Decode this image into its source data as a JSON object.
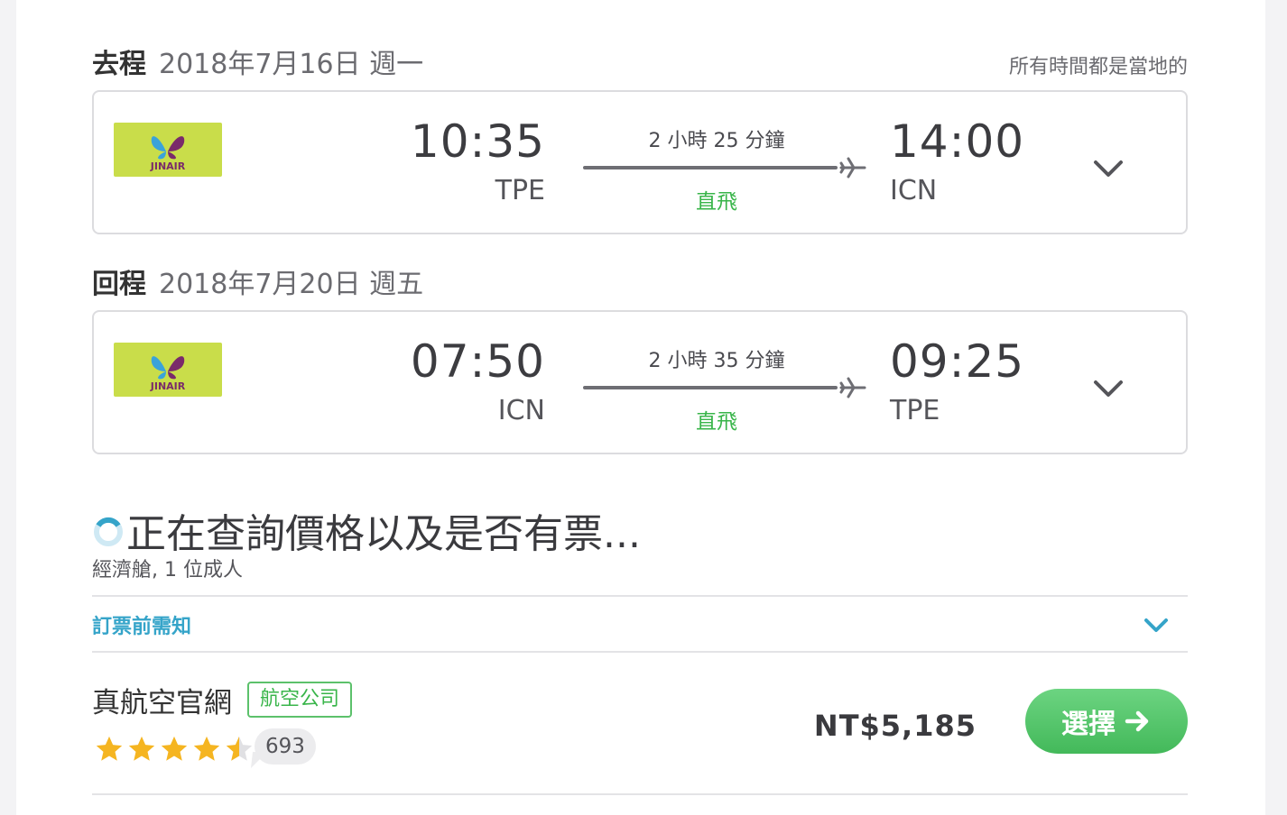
{
  "outbound": {
    "label": "去程",
    "date": "2018年7月16日 週一",
    "local_note": "所有時間都是當地的",
    "dep_time": "10:35",
    "dep_code": "TPE",
    "duration": "2 小時 25 分鐘",
    "stops": "直飛",
    "arr_time": "14:00",
    "arr_code": "ICN",
    "airline_logo_text": "JINAIR"
  },
  "inbound": {
    "label": "回程",
    "date": "2018年7月20日 週五",
    "dep_time": "07:50",
    "dep_code": "ICN",
    "duration": "2 小時 35 分鐘",
    "stops": "直飛",
    "arr_time": "09:25",
    "arr_code": "TPE",
    "airline_logo_text": "JINAIR"
  },
  "loading": {
    "text": "正在查詢價格以及是否有票...",
    "cabin_info": "經濟艙, 1 位成人"
  },
  "notice": {
    "label": "訂票前需知"
  },
  "provider": {
    "name": "真航空官網",
    "badge": "航空公司",
    "rating": 4.5,
    "reviews": "693",
    "price": "NT$5,185",
    "select_label": "選擇"
  },
  "colors": {
    "accent_green": "#39b54a",
    "link_blue": "#35a4c9",
    "logo_bg": "#c9dd4a",
    "star": "#f5b521"
  }
}
